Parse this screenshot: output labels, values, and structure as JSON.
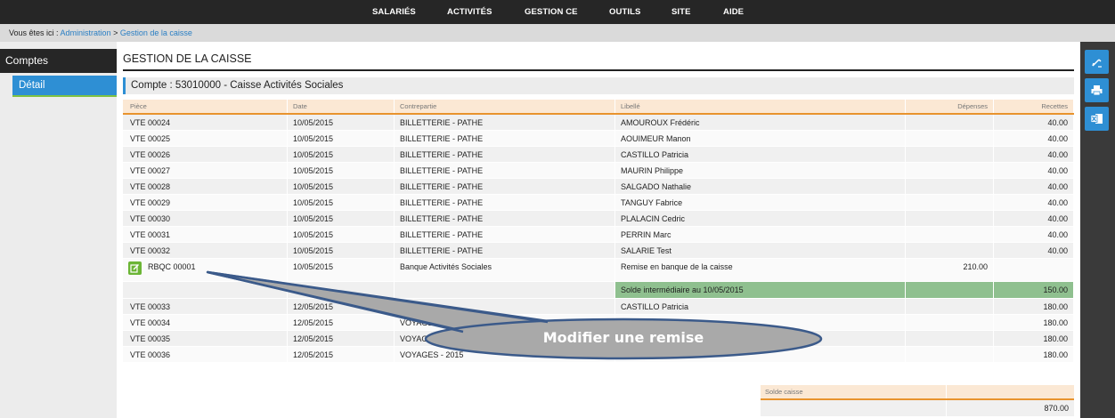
{
  "topnav": {
    "items": [
      {
        "label": "SALARIÉS"
      },
      {
        "label": "ACTIVITÉS"
      },
      {
        "label": "GESTION CE"
      },
      {
        "label": "OUTILS"
      },
      {
        "label": "SITE"
      },
      {
        "label": "AIDE"
      }
    ]
  },
  "breadcrumb": {
    "prefix": "Vous êtes ici :",
    "link1": "Administration",
    "separator": ">",
    "link2": "Gestion de la caisse"
  },
  "sidebar": {
    "title": "Comptes",
    "active_item": "Détail"
  },
  "main": {
    "page_title": "GESTION DE LA CAISSE",
    "account_label": "Compte : 53010000 - Caisse Activités Sociales"
  },
  "table": {
    "headers": [
      "Pièce",
      "Date",
      "Contrepartie",
      "Libellé",
      "Dépenses",
      "Recettes"
    ],
    "rows_before": [
      {
        "piece": "VTE 00024",
        "date": "10/05/2015",
        "contrepartie": "BILLETTERIE - PATHE",
        "libelle": "AMOUROUX Frédéric",
        "depenses": "",
        "recettes": "40.00"
      },
      {
        "piece": "VTE 00025",
        "date": "10/05/2015",
        "contrepartie": "BILLETTERIE - PATHE",
        "libelle": "AOUIMEUR Manon",
        "depenses": "",
        "recettes": "40.00"
      },
      {
        "piece": "VTE 00026",
        "date": "10/05/2015",
        "contrepartie": "BILLETTERIE - PATHE",
        "libelle": "CASTILLO Patricia",
        "depenses": "",
        "recettes": "40.00"
      },
      {
        "piece": "VTE 00027",
        "date": "10/05/2015",
        "contrepartie": "BILLETTERIE - PATHE",
        "libelle": "MAURIN Philippe",
        "depenses": "",
        "recettes": "40.00"
      },
      {
        "piece": "VTE 00028",
        "date": "10/05/2015",
        "contrepartie": "BILLETTERIE - PATHE",
        "libelle": "SALGADO Nathalie",
        "depenses": "",
        "recettes": "40.00"
      },
      {
        "piece": "VTE 00029",
        "date": "10/05/2015",
        "contrepartie": "BILLETTERIE - PATHE",
        "libelle": "TANGUY Fabrice",
        "depenses": "",
        "recettes": "40.00"
      },
      {
        "piece": "VTE 00030",
        "date": "10/05/2015",
        "contrepartie": "BILLETTERIE - PATHE",
        "libelle": "PLALACIN Cedric",
        "depenses": "",
        "recettes": "40.00"
      },
      {
        "piece": "VTE 00031",
        "date": "10/05/2015",
        "contrepartie": "BILLETTERIE - PATHE",
        "libelle": "PERRIN Marc",
        "depenses": "",
        "recettes": "40.00"
      },
      {
        "piece": "VTE 00032",
        "date": "10/05/2015",
        "contrepartie": "BILLETTERIE - PATHE",
        "libelle": "SALARIE Test",
        "depenses": "",
        "recettes": "40.00"
      }
    ],
    "remise_row": {
      "piece": "RBQC 00001",
      "date": "10/05/2015",
      "contrepartie": "Banque Activités Sociales",
      "libelle": "Remise en banque de la caisse",
      "depenses": "210.00",
      "recettes": ""
    },
    "subtotal_row": {
      "libelle": "Solde intermédiaire au 10/05/2015",
      "recettes": "150.00"
    },
    "rows_after": [
      {
        "piece": "VTE 00033",
        "date": "12/05/2015",
        "contrepartie": "",
        "libelle": "CASTILLO Patricia",
        "depenses": "",
        "recettes": "180.00"
      },
      {
        "piece": "VTE 00034",
        "date": "12/05/2015",
        "contrepartie": "VOYAGES - 2015",
        "libelle": "",
        "depenses": "",
        "recettes": "180.00"
      },
      {
        "piece": "VTE 00035",
        "date": "12/05/2015",
        "contrepartie": "VOYAG",
        "libelle": "",
        "depenses": "",
        "recettes": "180.00"
      },
      {
        "piece": "VTE 00036",
        "date": "12/05/2015",
        "contrepartie": "VOYAGES - 2015",
        "libelle": "",
        "depenses": "",
        "recettes": "180.00"
      }
    ]
  },
  "solde_caisse": {
    "label": "Solde caisse",
    "value": "870.00"
  },
  "rightbar": {
    "buttons": [
      "edit-icon",
      "print-icon",
      "excel-icon"
    ]
  },
  "callout": {
    "text": "Modifier une remise"
  },
  "colors": {
    "accent_blue": "#2e8fd4",
    "header_orange": "#e8932d",
    "header_bg": "#fbe8d4",
    "subtotal_green": "#8fc08f",
    "edit_green": "#6bb535",
    "callout_fill": "#a9a9a9",
    "callout_stroke": "#3b5a8a"
  }
}
